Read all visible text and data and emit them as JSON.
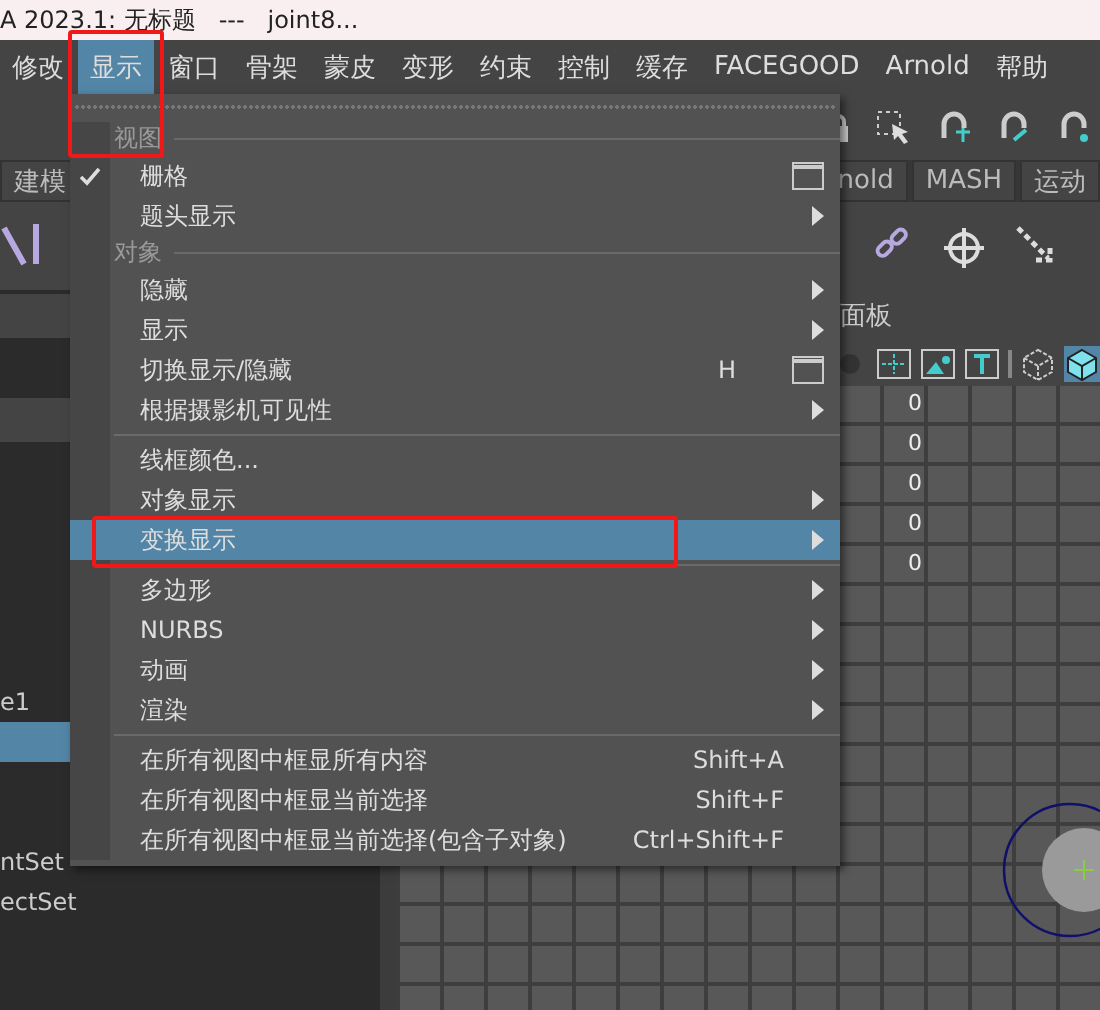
{
  "window": {
    "title": "A 2023.1: 无标题   ---   joint8..."
  },
  "menubar": [
    {
      "label": "修改",
      "selected": false
    },
    {
      "label": "显示",
      "selected": true
    },
    {
      "label": "窗口",
      "selected": false
    },
    {
      "label": "骨架",
      "selected": false
    },
    {
      "label": "蒙皮",
      "selected": false
    },
    {
      "label": "变形",
      "selected": false
    },
    {
      "label": "约束",
      "selected": false
    },
    {
      "label": "控制",
      "selected": false
    },
    {
      "label": "缓存",
      "selected": false
    },
    {
      "label": "FACEGOOD",
      "selected": false
    },
    {
      "label": "Arnold",
      "selected": false
    },
    {
      "label": "帮助",
      "selected": false
    }
  ],
  "shelf_tabs": [
    "建模",
    "nold",
    "MASH",
    "运动"
  ],
  "outliner": {
    "items": [
      {
        "label": "e1",
        "selected": false
      },
      {
        "selected": true
      },
      {
        "label": "ntSet",
        "selected": false
      },
      {
        "label": "ectSet",
        "selected": false
      }
    ]
  },
  "viewport": {
    "panel_label": "面板",
    "values": [
      "0",
      "0",
      "0",
      "0",
      "0"
    ]
  },
  "menu": {
    "items": [
      {
        "kind": "header",
        "label": "视图"
      },
      {
        "kind": "item",
        "label": "栅格",
        "checked": true,
        "option_box": true,
        "submenu": false,
        "selected": false
      },
      {
        "kind": "item",
        "label": "题头显示",
        "checked": false,
        "option_box": false,
        "submenu": true,
        "selected": false
      },
      {
        "kind": "header",
        "label": "对象"
      },
      {
        "kind": "item",
        "label": "隐藏",
        "checked": false,
        "option_box": false,
        "submenu": true,
        "selected": false
      },
      {
        "kind": "item",
        "label": "显示",
        "checked": false,
        "option_box": false,
        "submenu": true,
        "selected": false
      },
      {
        "kind": "item",
        "label": "切换显示/隐藏",
        "shortcut": "H",
        "checked": false,
        "option_box": true,
        "submenu": false,
        "selected": false
      },
      {
        "kind": "item",
        "label": "根据摄影机可见性",
        "checked": false,
        "option_box": false,
        "submenu": true,
        "selected": false
      },
      {
        "kind": "separator"
      },
      {
        "kind": "item",
        "label": "线框颜色...",
        "checked": false,
        "option_box": false,
        "submenu": false,
        "selected": false
      },
      {
        "kind": "item",
        "label": "对象显示",
        "checked": false,
        "option_box": false,
        "submenu": true,
        "selected": false
      },
      {
        "kind": "item",
        "label": "变换显示",
        "checked": false,
        "option_box": false,
        "submenu": true,
        "selected": true
      },
      {
        "kind": "separator"
      },
      {
        "kind": "item",
        "label": "多边形",
        "checked": false,
        "option_box": false,
        "submenu": true,
        "selected": false
      },
      {
        "kind": "item",
        "label": "NURBS",
        "checked": false,
        "option_box": false,
        "submenu": true,
        "selected": false
      },
      {
        "kind": "item",
        "label": "动画",
        "checked": false,
        "option_box": false,
        "submenu": true,
        "selected": false
      },
      {
        "kind": "item",
        "label": "渲染",
        "checked": false,
        "option_box": false,
        "submenu": true,
        "selected": false
      },
      {
        "kind": "separator"
      },
      {
        "kind": "item",
        "label": "在所有视图中框显所有内容",
        "shortcut": "Shift+A",
        "checked": false,
        "option_box": false,
        "submenu": false,
        "selected": false
      },
      {
        "kind": "item",
        "label": "在所有视图中框显当前选择",
        "shortcut": "Shift+F",
        "checked": false,
        "option_box": false,
        "submenu": false,
        "selected": false
      },
      {
        "kind": "item",
        "label": "在所有视图中框显当前选择(包含子对象)",
        "shortcut": "Ctrl+Shift+F",
        "checked": false,
        "option_box": false,
        "submenu": false,
        "selected": false
      }
    ]
  }
}
